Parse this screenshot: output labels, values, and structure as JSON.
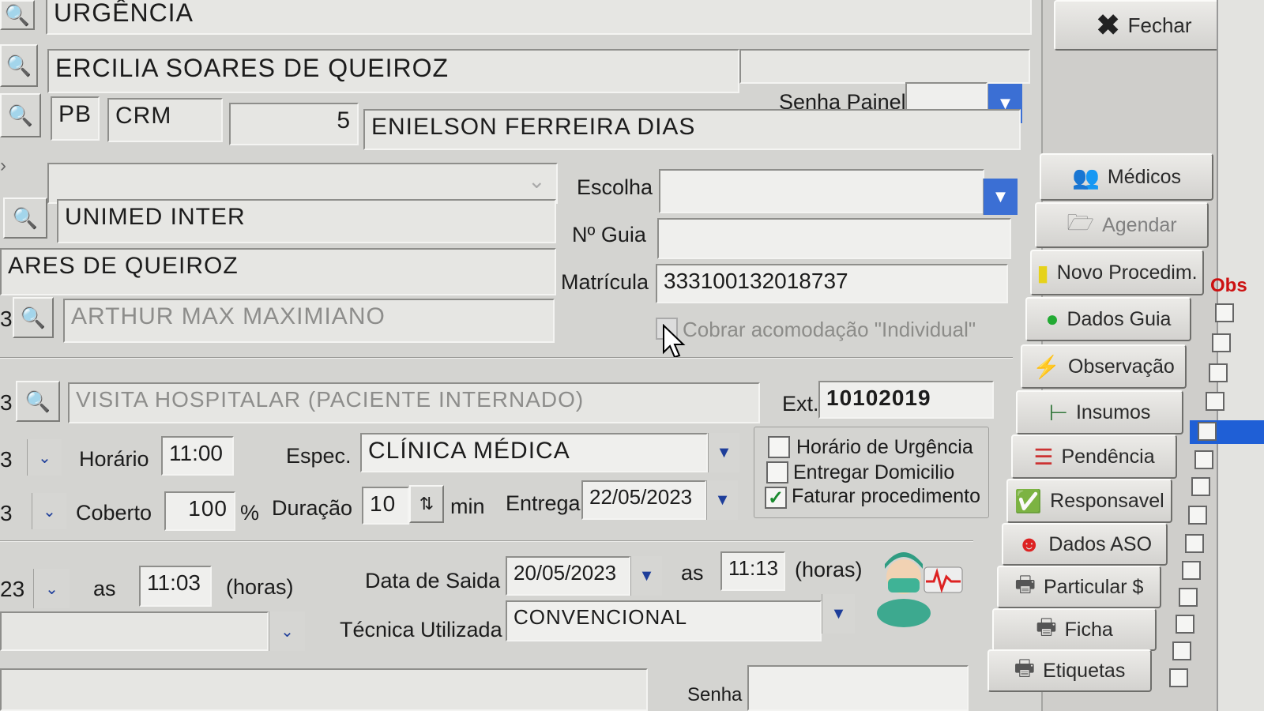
{
  "row_sector": "URGÊNCIA",
  "patient_name": "ERCILIA SOARES DE QUEIROZ",
  "senha_painel": {
    "label": "Senha Painel",
    "value": ""
  },
  "doctor": {
    "uf": "PB",
    "council": "CRM",
    "number": "5",
    "name": "ENIELSON FERREIRA DIAS"
  },
  "escolha": {
    "label": "Escolha",
    "value": ""
  },
  "insurer": "UNIMED INTER",
  "guia": {
    "label": "Nº Guia",
    "value": ""
  },
  "holder": "ARES DE QUEIROZ",
  "matricula": {
    "label": "Matrícula",
    "value": "333100132018737"
  },
  "requester": "ARTHUR MAX MAXIMIANO",
  "cobrar_acomodacao": "Cobrar acomodação \"Individual\"",
  "procedure": "VISITA HOSPITALAR (PACIENTE INTERNADO)",
  "ext": {
    "label": "Ext.",
    "value": "10102019"
  },
  "horario": {
    "label": "Horário",
    "value": "11:00"
  },
  "espec": {
    "label": "Espec.",
    "value": "CLÍNICA MÉDICA"
  },
  "coberto": {
    "label": "Coberto",
    "value": "100",
    "unit": "%"
  },
  "duracao": {
    "label": "Duração",
    "value": "10",
    "unit": "min"
  },
  "entrega": {
    "label": "Entrega",
    "value": "22/05/2023"
  },
  "checkboxes": [
    {
      "label": "Horário de Urgência",
      "checked": false
    },
    {
      "label": "Entregar Domicilio",
      "checked": false
    },
    {
      "label": "Faturar procedimento",
      "checked": true
    }
  ],
  "left_edge": {
    "r1": "3",
    "r2": "3",
    "r3": "3",
    "r4": "23",
    "r5": "3"
  },
  "entrada": {
    "as": "as",
    "time": "11:03",
    "unit": "(horas)"
  },
  "saida": {
    "label": "Data de Saida",
    "date": "20/05/2023",
    "as": "as",
    "time": "11:13",
    "unit": "(horas)"
  },
  "tecnica": {
    "label": "Técnica Utilizada",
    "value": "CONVENCIONAL"
  },
  "senha_bottom": "Senha",
  "sidebar": {
    "close": "Fechar",
    "buttons": [
      {
        "label": "Médicos",
        "icon": "doctors-icon"
      },
      {
        "label": "Agendar",
        "icon": "folder-icon",
        "disabled": true
      },
      {
        "label": "Novo Procedim.",
        "icon": "document-icon"
      },
      {
        "label": "Dados Guia",
        "icon": "green-dot-icon"
      },
      {
        "label": "Observação",
        "icon": "lightning-icon"
      },
      {
        "label": "Insumos",
        "icon": "syringe-icon"
      },
      {
        "label": "Pendência",
        "icon": "list-icon"
      },
      {
        "label": "Responsavel",
        "icon": "check-icon"
      },
      {
        "label": "Dados ASO",
        "icon": "face-icon"
      },
      {
        "label": "Particular $",
        "icon": "printer-icon"
      },
      {
        "label": "Ficha",
        "icon": "printer-icon"
      },
      {
        "label": "Etiquetas",
        "icon": "printer-icon"
      }
    ]
  },
  "grid_header": "Obs",
  "colors": {
    "accent_blue": "#3b6fd4",
    "grid_header_red": "#cc1111",
    "selected_row": "#1f5fd6"
  }
}
